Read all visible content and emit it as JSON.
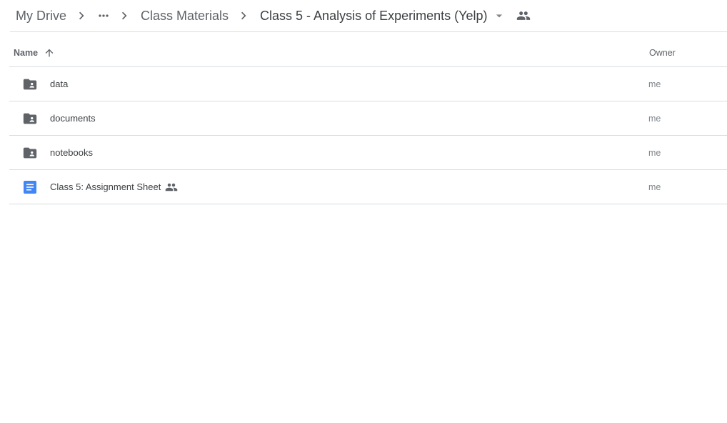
{
  "breadcrumb": {
    "root": "My Drive",
    "more_icon": "more-horiz-icon",
    "parent": "Class Materials",
    "current": "Class 5 - Analysis of Experiments (Yelp)"
  },
  "columns": {
    "name": "Name",
    "owner": "Owner"
  },
  "files": [
    {
      "name": "data",
      "type": "shared-folder",
      "owner": "me",
      "shared": false
    },
    {
      "name": "documents",
      "type": "shared-folder",
      "owner": "me",
      "shared": false
    },
    {
      "name": "notebooks",
      "type": "shared-folder",
      "owner": "me",
      "shared": false
    },
    {
      "name": "Class 5: Assignment Sheet",
      "type": "google-doc",
      "owner": "me",
      "shared": true
    }
  ],
  "colors": {
    "folder": "#5f6368",
    "doc": "#4285f4",
    "divider": "#dadce0"
  }
}
